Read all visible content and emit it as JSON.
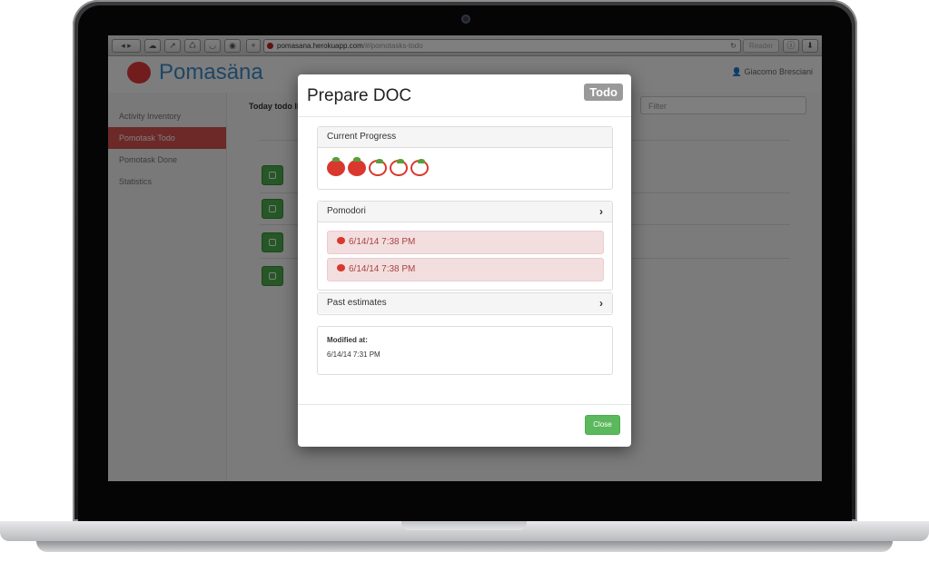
{
  "browser": {
    "url_host": "pomasana.herokuapp.com",
    "url_path": "/#/pomotasks-todo",
    "reader_label": "Reader"
  },
  "app": {
    "logo_text": "Pomasäna",
    "user_name": "Giacomo Bresciani",
    "sidebar": [
      {
        "label": "Activity Inventory",
        "active": false
      },
      {
        "label": "Pomotask Todo",
        "active": true
      },
      {
        "label": "Pomotask Done",
        "active": false
      },
      {
        "label": "Statistics",
        "active": false
      }
    ],
    "main": {
      "today_label": "Today todo lis",
      "filter_placeholder": "Filter"
    }
  },
  "modal": {
    "title": "Prepare DOC",
    "status_badge": "Todo",
    "progress": {
      "heading": "Current Progress",
      "completed": 2,
      "total": 5
    },
    "pomodori": {
      "heading": "Pomodori",
      "entries": [
        "6/14/14 7:38 PM",
        "6/14/14 7:38 PM"
      ]
    },
    "past_estimates": {
      "heading": "Past estimates"
    },
    "modified": {
      "label": "Modified at:",
      "value": "6/14/14 7:31 PM"
    },
    "close_label": "Close"
  },
  "colors": {
    "accent_red": "#d9534f",
    "tomato": "#d9382f",
    "success_green": "#5cb85c",
    "logo_blue": "#3b8ccc"
  }
}
